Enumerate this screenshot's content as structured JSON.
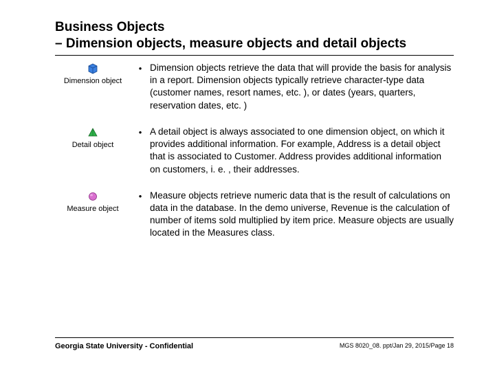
{
  "slide": {
    "title_line1": "Business Objects",
    "title_line2": "– Dimension objects, measure objects and detail objects"
  },
  "items": [
    {
      "icon_label": "Dimension object",
      "text": "Dimension objects retrieve the data that will provide the basis for analysis in a report.  Dimension objects typically retrieve character-type data (customer names, resort names, etc. ), or dates (years, quarters, reservation dates, etc. )"
    },
    {
      "icon_label": "Detail object",
      "text": "A detail object is always associated to one dimension object, on which it provides additional information. For example, Address is a detail object that is associated to Customer. Address provides additional information on customers, i. e. , their addresses."
    },
    {
      "icon_label": "Measure object",
      "text": "Measure objects retrieve numeric data that is the result of calculations on data in the database. In the demo universe, Revenue is the calculation of number of items sold multiplied by item price. Measure objects are usually located in the Measures class."
    }
  ],
  "footer": {
    "left": "Georgia State University - Confidential",
    "right": "MGS 8020_08. ppt/Jan 29, 2015/Page 18"
  },
  "bullet": "•"
}
